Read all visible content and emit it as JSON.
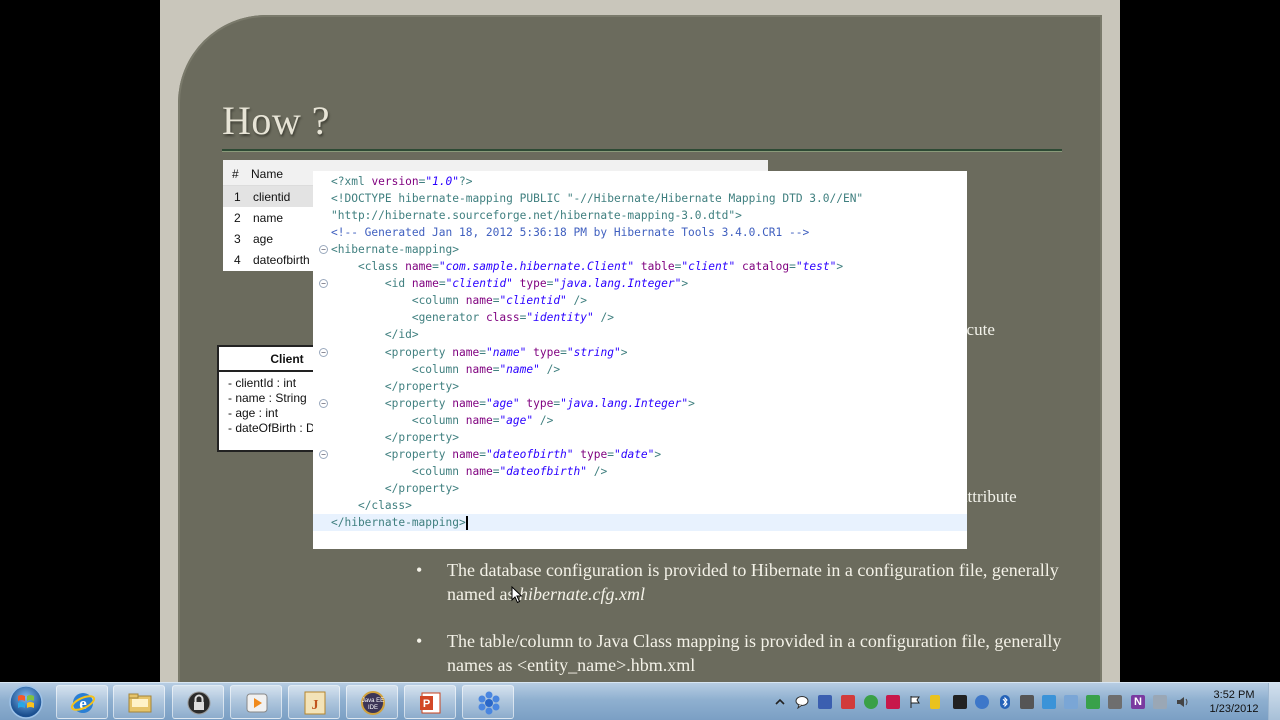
{
  "slide": {
    "title": "How ?",
    "db_table": {
      "headers": [
        "#",
        "Name"
      ],
      "rows": [
        {
          "num": "1",
          "name": "clientid"
        },
        {
          "num": "2",
          "name": "name"
        },
        {
          "num": "3",
          "name": "age"
        },
        {
          "num": "4",
          "name": "dateofbirth"
        }
      ]
    },
    "uml": {
      "class_name": "Client",
      "attributes": [
        "- clientId : int",
        "- name : String",
        "- age : int",
        "- dateOfBirth : D"
      ]
    },
    "partial_text_1": "ecute",
    "partial_text_2": "attribute",
    "bullets": [
      {
        "text": "The database configuration is provided to Hibernate in a configuration file, generally named as ",
        "emphasis": "hibernate.cfg.xml"
      },
      {
        "text": "The table/column to Java Class mapping is provided in a configuration file, generally names as <entity_name>.hbm.xml",
        "emphasis": ""
      }
    ],
    "bullet_symbol": "•"
  },
  "xml_editor": {
    "lines": [
      "<?xml version=\"1.0\"?>",
      "<!DOCTYPE hibernate-mapping PUBLIC \"-//Hibernate/Hibernate Mapping DTD 3.0//EN\"",
      "\"http://hibernate.sourceforge.net/hibernate-mapping-3.0.dtd\">",
      "<!-- Generated Jan 18, 2012 5:36:18 PM by Hibernate Tools 3.4.0.CR1 -->",
      "<hibernate-mapping>",
      "    <class name=\"com.sample.hibernate.Client\" table=\"client\" catalog=\"test\">",
      "        <id name=\"clientid\" type=\"java.lang.Integer\">",
      "            <column name=\"clientid\" />",
      "            <generator class=\"identity\" />",
      "        </id>",
      "        <property name=\"name\" type=\"string\">",
      "            <column name=\"name\" />",
      "        </property>",
      "        <property name=\"age\" type=\"java.lang.Integer\">",
      "            <column name=\"age\" />",
      "        </property>",
      "        <property name=\"dateofbirth\" type=\"date\">",
      "            <column name=\"dateofbirth\" />",
      "        </property>",
      "    </class>",
      "</hibernate-mapping>"
    ]
  },
  "taskbar": {
    "apps": [
      "internet-explorer",
      "file-explorer",
      "lock-app",
      "media-player",
      "java-tool",
      "java-ee-ide",
      "powerpoint",
      "snowflake-app"
    ],
    "clock_time": "3:52 PM",
    "clock_date": "1/23/2012"
  },
  "colors": {
    "slide_bg": "#6b6b5d",
    "xml_tag": "#3f7f7f",
    "xml_attr": "#7f007f",
    "xml_value": "#2a00ff",
    "xml_comment": "#3f5fbf"
  }
}
